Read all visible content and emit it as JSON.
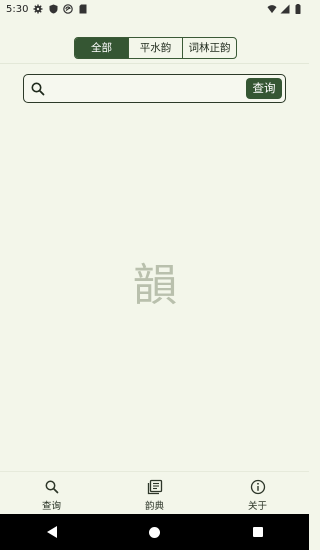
{
  "status_bar": {
    "time": "5:30",
    "icons": [
      "gear-icon",
      "shield-icon",
      "sync-icon",
      "sd-card-icon"
    ],
    "right_icons": [
      "wifi-icon",
      "signal-icon",
      "battery-icon"
    ]
  },
  "tabs": [
    {
      "label": "全部",
      "active": true
    },
    {
      "label": "平水韵",
      "active": false
    },
    {
      "label": "词林正韵",
      "active": false
    }
  ],
  "search": {
    "value": "",
    "placeholder": "",
    "button_label": "查询"
  },
  "center_mark": "韻",
  "bottom_nav": [
    {
      "label": "查询",
      "icon": "search-icon",
      "active": true
    },
    {
      "label": "韵典",
      "icon": "book-icon",
      "active": false
    },
    {
      "label": "关于",
      "icon": "info-icon",
      "active": false
    }
  ],
  "colors": {
    "background": "#f3f6ea",
    "accent": "#355633"
  }
}
